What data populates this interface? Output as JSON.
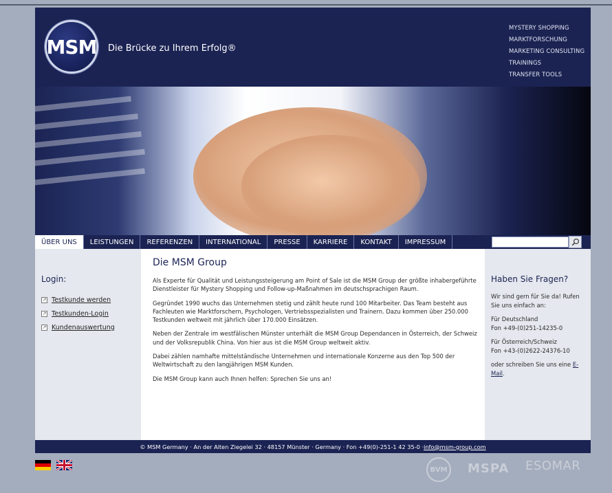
{
  "header": {
    "logo_text": "MSM",
    "slogan": "Die Brücke zu Ihrem Erfolg®",
    "top_nav": [
      "MYSTERY SHOPPING",
      "MARKTFORSCHUNG",
      "MARKETING CONSULTING",
      "TRAININGS",
      "TRANSFER TOOLS"
    ]
  },
  "nav": {
    "tabs": [
      "ÜBER UNS",
      "LEISTUNGEN",
      "REFERENZEN",
      "INTERNATIONAL",
      "PRESSE",
      "KARRIERE",
      "KONTAKT",
      "IMPRESSUM"
    ],
    "active": "ÜBER UNS",
    "search_value": ""
  },
  "left": {
    "title": "Login:",
    "links": [
      "Testkunde werden",
      "Testkunden-Login",
      "Kundenauswertung"
    ]
  },
  "main": {
    "title": "Die MSM Group",
    "paragraphs": [
      "Als Experte für Qualität und Leistungssteigerung am Point of Sale ist die MSM Group der größte inhabergeführte Dienstleister für Mystery Shopping und Follow-up-Maßnahmen im deutschsprachigen Raum.",
      "Gegründet 1990 wuchs das Unternehmen stetig und zählt heute rund 100 Mitarbeiter. Das Team besteht aus Fachleuten wie Marktforschern, Psychologen, Vertriebsspezialisten und Trainern. Dazu kommen über 250.000 Testkunden weltweit mit jährlich über 170.000 Einsätzen.",
      "Neben der Zentrale im westfälischen Münster unterhält die MSM Group Dependancen in Österreich, der Schweiz und der Volksrepublik China. Von hier aus ist die MSM Group weltweit aktiv.",
      "Dabei zählen namhafte mittelständische Unternehmen und internationale Konzerne aus den Top 500 der Weltwirtschaft zu den langjährigen MSM Kunden.",
      "Die MSM Group kann auch Ihnen helfen: Sprechen Sie uns an!"
    ]
  },
  "right": {
    "title": "Haben Sie Fragen?",
    "intro": "Wir sind gern für Sie da! Rufen Sie uns einfach an:",
    "de_label": "Für Deutschland",
    "de_phone": "Fon +49-(0)251-14235-0",
    "at_label": "Für Österreich/Schweiz",
    "at_phone": "Fon +43-(0)2622-24376-10",
    "mail_text": "oder schreiben Sie uns eine",
    "mail_link": "E-Mail"
  },
  "footer": {
    "text": "© MSM Germany · An der Alten Ziegelei 32 · 48157 Münster · Germany · Fon +49(0)-251-1 42 35-0 · ",
    "email": "info@msm-group.com"
  },
  "partners": [
    "BVM",
    "MSPA",
    "ESOMAR"
  ],
  "colors": {
    "navy": "#1b2353",
    "background": "#a4adbd",
    "panel": "#e5e8ee"
  }
}
